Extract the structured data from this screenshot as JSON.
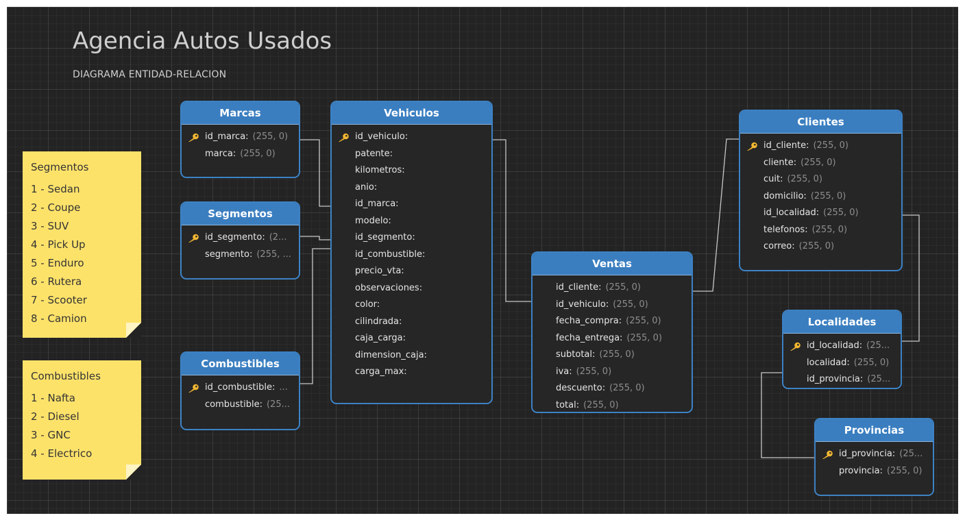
{
  "diagram": {
    "title": "Agencia Autos Usados",
    "subtitle": "DIAGRAMA ENTIDAD-RELACION"
  },
  "notes": {
    "segmentos": {
      "title": "Segmentos",
      "items": [
        "1 - Sedan",
        "2 - Coupe",
        "3 - SUV",
        "4 - Pick Up",
        "5 - Enduro",
        "6 - Rutera",
        "7 - Scooter",
        "8 - Camion"
      ]
    },
    "combustibles": {
      "title": "Combustibles",
      "items": [
        "1 - Nafta",
        "2 - Diesel",
        "3 - GNC",
        "4 - Electrico"
      ]
    }
  },
  "entities": {
    "marcas": {
      "name": "Marcas",
      "fields": [
        {
          "name": "id_marca:",
          "type": "(255, 0)",
          "key": true
        },
        {
          "name": "marca:",
          "type": "(255, 0)",
          "key": false
        }
      ]
    },
    "segmentos": {
      "name": "Segmentos",
      "fields": [
        {
          "name": "id_segmento:",
          "type": "(2...",
          "key": true
        },
        {
          "name": "segmento:",
          "type": "(255, ...",
          "key": false
        }
      ]
    },
    "combustibles": {
      "name": "Combustibles",
      "fields": [
        {
          "name": "id_combustible:",
          "type": "...",
          "key": true
        },
        {
          "name": "combustible:",
          "type": "(25...",
          "key": false
        }
      ]
    },
    "vehiculos": {
      "name": "Vehiculos",
      "fields": [
        {
          "name": "id_vehiculo:",
          "type": "",
          "key": true
        },
        {
          "name": "patente:",
          "type": "",
          "key": false
        },
        {
          "name": "kilometros:",
          "type": "",
          "key": false
        },
        {
          "name": "anio:",
          "type": "",
          "key": false
        },
        {
          "name": "id_marca:",
          "type": "",
          "key": false
        },
        {
          "name": "modelo:",
          "type": "",
          "key": false
        },
        {
          "name": "id_segmento:",
          "type": "",
          "key": false
        },
        {
          "name": "id_combustible:",
          "type": "",
          "key": false
        },
        {
          "name": "precio_vta:",
          "type": "",
          "key": false
        },
        {
          "name": "observaciones:",
          "type": "",
          "key": false
        },
        {
          "name": "color:",
          "type": "",
          "key": false
        },
        {
          "name": "cilindrada:",
          "type": "",
          "key": false
        },
        {
          "name": "caja_carga:",
          "type": "",
          "key": false
        },
        {
          "name": "dimension_caja:",
          "type": "",
          "key": false
        },
        {
          "name": "carga_max:",
          "type": "",
          "key": false
        }
      ]
    },
    "ventas": {
      "name": "Ventas",
      "fields": [
        {
          "name": "id_cliente:",
          "type": "(255, 0)",
          "key": false
        },
        {
          "name": "id_vehiculo:",
          "type": "(255, 0)",
          "key": false
        },
        {
          "name": "fecha_compra:",
          "type": "(255, 0)",
          "key": false
        },
        {
          "name": "fecha_entrega:",
          "type": "(255, 0)",
          "key": false
        },
        {
          "name": "subtotal:",
          "type": "(255, 0)",
          "key": false
        },
        {
          "name": "iva:",
          "type": "(255, 0)",
          "key": false
        },
        {
          "name": "descuento:",
          "type": "(255, 0)",
          "key": false
        },
        {
          "name": "total:",
          "type": "(255, 0)",
          "key": false
        }
      ]
    },
    "clientes": {
      "name": "Clientes",
      "fields": [
        {
          "name": "id_cliente:",
          "type": "(255, 0)",
          "key": true
        },
        {
          "name": "cliente:",
          "type": "(255, 0)",
          "key": false
        },
        {
          "name": "cuit:",
          "type": "(255, 0)",
          "key": false
        },
        {
          "name": "domicilio:",
          "type": "(255, 0)",
          "key": false
        },
        {
          "name": "id_localidad:",
          "type": "(255, 0)",
          "key": false
        },
        {
          "name": "telefonos:",
          "type": "(255, 0)",
          "key": false
        },
        {
          "name": "correo:",
          "type": "(255, 0)",
          "key": false
        }
      ]
    },
    "localidades": {
      "name": "Localidades",
      "fields": [
        {
          "name": "id_localidad:",
          "type": "(25...",
          "key": true
        },
        {
          "name": "localidad:",
          "type": "(255, 0)",
          "key": false
        },
        {
          "name": "id_provincia:",
          "type": "(25...",
          "key": false
        }
      ]
    },
    "provincias": {
      "name": "Provincias",
      "fields": [
        {
          "name": "id_provincia:",
          "type": "(25...",
          "key": true
        },
        {
          "name": "provincia:",
          "type": "(255, 0)",
          "key": false
        }
      ]
    }
  },
  "colors": {
    "canvas": "#232323",
    "entity_header": "#3a7ec0",
    "entity_border": "#3d82c4",
    "note": "#fde26a",
    "connector": "#c8c8c8",
    "key": "#f2b731"
  }
}
